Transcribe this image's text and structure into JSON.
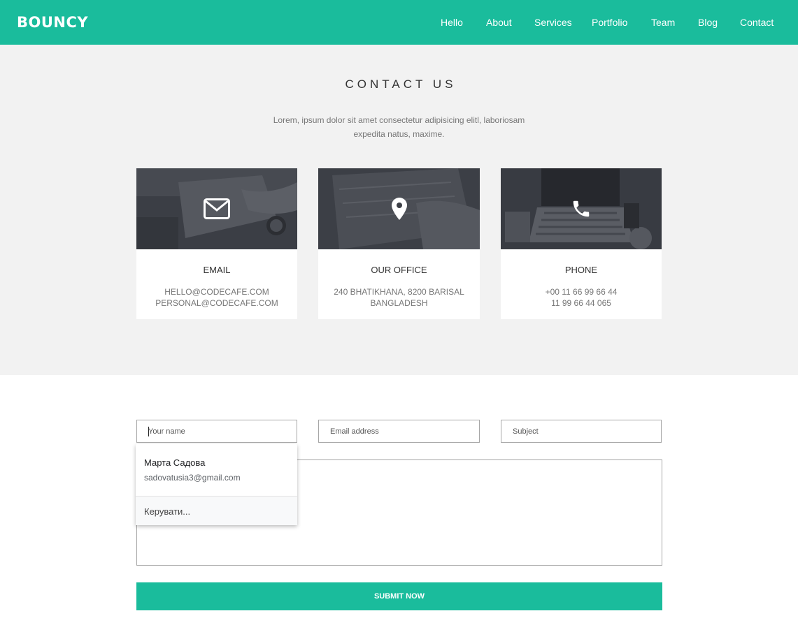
{
  "brand": {
    "logo": "BOUNCY",
    "accent": "#1abc9c"
  },
  "nav": {
    "items": [
      {
        "label": "Hello"
      },
      {
        "label": "About"
      },
      {
        "label": "Services"
      },
      {
        "label": "Portfolio"
      },
      {
        "label": "Team"
      },
      {
        "label": "Blog"
      },
      {
        "label": "Contact"
      }
    ]
  },
  "contact": {
    "title": "CONTACT US",
    "description_line1": "Lorem, ipsum dolor sit amet consectetur adipisicing elitl, laboriosam",
    "description_line2": "expedita natus, maxime.",
    "cards": [
      {
        "icon": "envelope-icon",
        "title": "EMAIL",
        "lines": [
          "HELLO@CODECAFE.COM",
          "PERSONAL@CODECAFE.COM"
        ]
      },
      {
        "icon": "map-pin-icon",
        "title": "OUR OFFICE",
        "lines": [
          "240 BHATIKHANA, 8200 BARISAL",
          "BANGLADESH"
        ]
      },
      {
        "icon": "phone-icon",
        "title": "PHONE",
        "lines": [
          "+00 11 66 99 66 44",
          "11 99 66 44 065"
        ]
      }
    ]
  },
  "form": {
    "name_placeholder": "Your name",
    "email_placeholder": "Email address",
    "subject_placeholder": "Subject",
    "message_value": "",
    "submit_label": "SUBMIT NOW"
  },
  "autocomplete": {
    "entry_name": "Марта Садова",
    "entry_email": "sadovatusia3@gmail.com",
    "manage_label": "Керувати..."
  }
}
